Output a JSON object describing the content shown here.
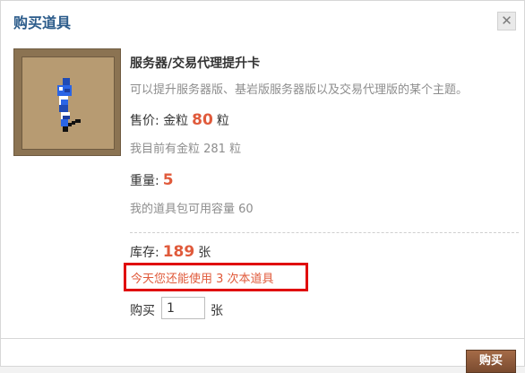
{
  "dialog": {
    "title": "购买道具",
    "close_icon": "close-icon"
  },
  "item": {
    "name": "服务器/交易代理提升卡",
    "description": "可以提升服务器版、基岩版服务器版以及交易代理版的某个主题。",
    "icon": "upgrade-card-icon"
  },
  "price": {
    "label": "售价:",
    "currency": "金粒",
    "value": "80",
    "unit": "粒",
    "balance_text": "我目前有金粒 281 粒"
  },
  "weight": {
    "label": "重量:",
    "value": "5",
    "capacity_text": "我的道具包可用容量 60"
  },
  "stock": {
    "label": "库存:",
    "value": "189",
    "unit": "张"
  },
  "notice": {
    "text": "今天您还能使用 3 次本道具"
  },
  "purchase": {
    "label": "购买",
    "quantity": "1",
    "unit": "张",
    "button_label": "购买"
  },
  "colors": {
    "title": "#2b5b8a",
    "highlight": "#e05a3b",
    "notice_border": "#e00a0a",
    "button": "#8b5a3c"
  }
}
